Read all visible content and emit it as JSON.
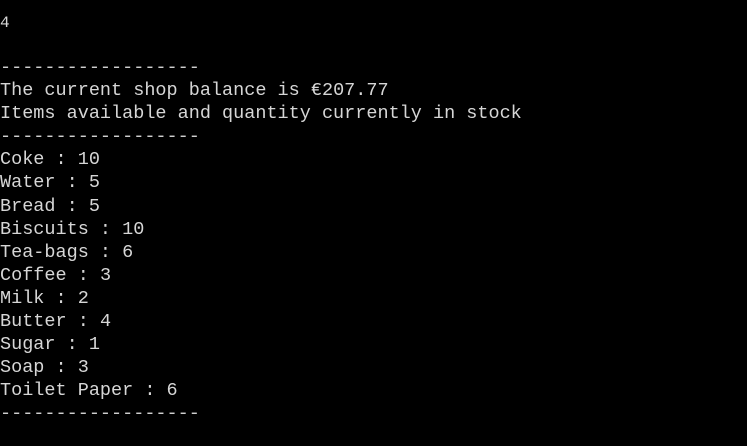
{
  "terminal": {
    "input_echo": "4",
    "separator": "------------------",
    "balance_prefix": "The current shop balance is ",
    "balance_value": "€207.77",
    "items_header": "Items available and quantity currently in stock",
    "items": [
      {
        "name": "Coke",
        "qty": "10"
      },
      {
        "name": "Water",
        "qty": "5"
      },
      {
        "name": "Bread",
        "qty": "5"
      },
      {
        "name": "Biscuits",
        "qty": "10"
      },
      {
        "name": "Tea-bags",
        "qty": "6"
      },
      {
        "name": "Coffee",
        "qty": "3"
      },
      {
        "name": "Milk",
        "qty": "2"
      },
      {
        "name": "Butter",
        "qty": "4"
      },
      {
        "name": "Sugar",
        "qty": "1"
      },
      {
        "name": "Soap",
        "qty": "3"
      },
      {
        "name": "Toilet Paper",
        "qty": "6"
      }
    ],
    "colors": {
      "background": "#000000",
      "text": "#d6d6d6"
    }
  }
}
